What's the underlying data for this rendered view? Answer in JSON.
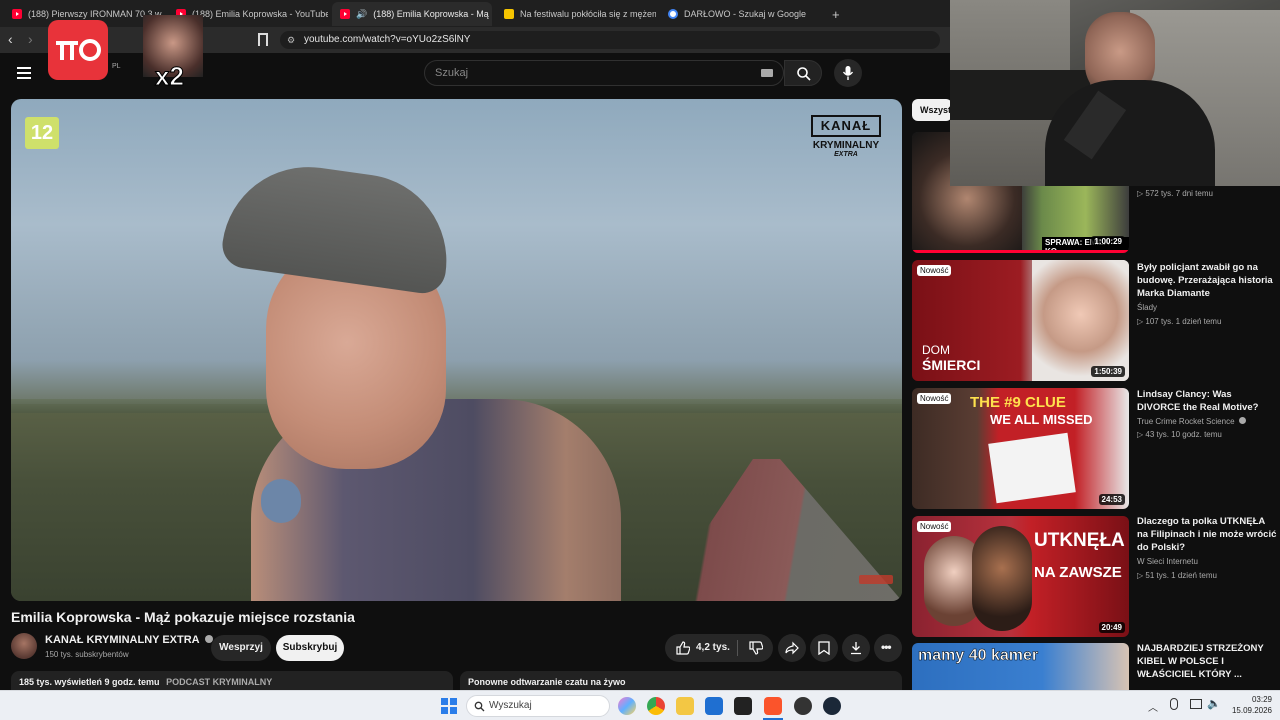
{
  "browser": {
    "tabs": [
      {
        "label": "(188) Pierwszy IRONMAN 70.3 w Pol"
      },
      {
        "label": "(188) Emilia Koprowska - YouTube"
      },
      {
        "label": "(188) Emilia Koprowska - Mą"
      },
      {
        "label": "Na festiwalu pokłóciła się z mężem, a"
      },
      {
        "label": "DARŁOWO - Szukaj w Google"
      }
    ],
    "new_tab": "+",
    "url": "youtube.com/watch?v=oYUo2zS6lNY"
  },
  "youtube": {
    "logo_suffix": "PL",
    "search_placeholder": "Szukaj"
  },
  "overlay": {
    "multiplier": "x2"
  },
  "video": {
    "channel_bug": "12",
    "brand_line1": "KANAŁ",
    "brand_line2": "KRYMINALNY",
    "brand_line3": "EXTRA",
    "title": "Emilia Koprowska - Mąż pokazuje miejsce rozstania",
    "channel_name": "KANAŁ KRYMINALNY EXTRA",
    "subscribers": "150 tys. subskrybentów",
    "support_label": "Wesprzyj",
    "subscribe_label": "Subskrybuj",
    "likes": "4,2 tys.",
    "views_line": "185 tys. wyświetleń  9 godz. temu",
    "category": "PODCAST KRYMINALNY",
    "chat_replay": "Ponowne odtwarzanie czatu na żywo"
  },
  "sidebar": {
    "chip": "Wszyst",
    "new_badge": "Nowość",
    "items": [
      {
        "title": "",
        "channel": "",
        "meta": "572 tys.   7 dni temu",
        "duration": "1:00:29",
        "thumb_caption": "SPRAWA: EMILA KO..."
      },
      {
        "title": "Były policjant zwabił go na budowę. Przerażająca historia Marka Diamante",
        "channel": "Ślady",
        "meta": "107 tys.   1 dzień temu",
        "duration": "1:50:39",
        "thumb_caption1": "DOM",
        "thumb_caption2": "ŚMIERCI"
      },
      {
        "title": "Lindsay Clancy: Was DIVORCE the Real Motive?",
        "channel": "True Crime Rocket Science",
        "meta": "43 tys.   10 godz. temu",
        "duration": "24:53",
        "thumb_caption1": "THE #9 CLUE",
        "thumb_caption2": "WE ALL MISSED"
      },
      {
        "title": "Dlaczego ta polka UTKNĘŁA na Filipinach i nie może wrócić do Polski?",
        "channel": "W Sieci Internetu",
        "meta": "51 tys.   1 dzień temu",
        "duration": "20:49",
        "thumb_caption1": "UTKNĘŁA",
        "thumb_caption2": "NA ZAWSZE"
      },
      {
        "title": "NAJBARDZIEJ STRZEŻONY KIBEL W POLSCE I WŁAŚCICIEL KTÓRY ...",
        "thumb_caption1": "mamy 40 kamer"
      }
    ]
  },
  "taskbar": {
    "search_placeholder": "Wyszukaj",
    "time": "03:29",
    "date": "15.09.2026"
  },
  "colors": {
    "yt_red": "#ff0033",
    "dark_bg": "#0f0f0f",
    "chip_bg": "#272727"
  }
}
